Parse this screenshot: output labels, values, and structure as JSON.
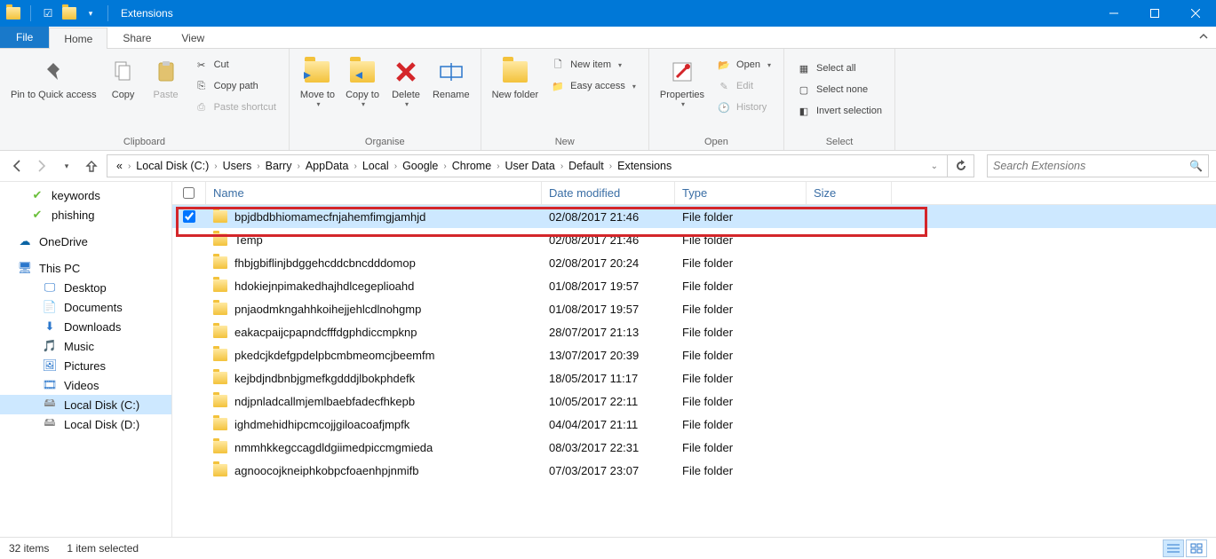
{
  "window": {
    "title": "Extensions"
  },
  "tabs": {
    "file": "File",
    "home": "Home",
    "share": "Share",
    "view": "View"
  },
  "ribbon": {
    "clipboard": {
      "label": "Clipboard",
      "pin": "Pin to Quick access",
      "copy": "Copy",
      "paste": "Paste",
      "cut": "Cut",
      "copypath": "Copy path",
      "pasteshortcut": "Paste shortcut"
    },
    "organise": {
      "label": "Organise",
      "moveto": "Move to",
      "copyto": "Copy to",
      "delete": "Delete",
      "rename": "Rename"
    },
    "new": {
      "label": "New",
      "newfolder": "New folder",
      "newitem": "New item",
      "easyaccess": "Easy access"
    },
    "open": {
      "label": "Open",
      "properties": "Properties",
      "open": "Open",
      "edit": "Edit",
      "history": "History"
    },
    "select": {
      "label": "Select",
      "selectall": "Select all",
      "selectnone": "Select none",
      "invert": "Invert selection"
    }
  },
  "breadcrumb": [
    "Local Disk (C:)",
    "Users",
    "Barry",
    "AppData",
    "Local",
    "Google",
    "Chrome",
    "User Data",
    "Default",
    "Extensions"
  ],
  "search": {
    "placeholder": "Search Extensions"
  },
  "navpane": {
    "keywords": "keywords",
    "phishing": "phishing",
    "onedrive": "OneDrive",
    "thispc": "This PC",
    "desktop": "Desktop",
    "documents": "Documents",
    "downloads": "Downloads",
    "music": "Music",
    "pictures": "Pictures",
    "videos": "Videos",
    "localc": "Local Disk (C:)",
    "locald": "Local Disk (D:)"
  },
  "columns": {
    "name": "Name",
    "date": "Date modified",
    "type": "Type",
    "size": "Size"
  },
  "files": [
    {
      "name": "bpjdbdbhiomamecfnjahemfimgjamhjd",
      "date": "02/08/2017 21:46",
      "type": "File folder",
      "selected": true
    },
    {
      "name": "Temp",
      "date": "02/08/2017 21:46",
      "type": "File folder"
    },
    {
      "name": "fhbjgbiflinjbdggehcddcbncdddomop",
      "date": "02/08/2017 20:24",
      "type": "File folder"
    },
    {
      "name": "hdokiejnpimakedhajhdlcegeplioahd",
      "date": "01/08/2017 19:57",
      "type": "File folder"
    },
    {
      "name": "pnjaodmkngahhkoihejjehlcdlnohgmp",
      "date": "01/08/2017 19:57",
      "type": "File folder"
    },
    {
      "name": "eakacpaijcpapndcfffdgphdiccmpknp",
      "date": "28/07/2017 21:13",
      "type": "File folder"
    },
    {
      "name": "pkedcjkdefgpdelpbcmbmeomcjbeemfm",
      "date": "13/07/2017 20:39",
      "type": "File folder"
    },
    {
      "name": "kejbdjndbnbjgmefkgdddjlbokphdefk",
      "date": "18/05/2017 11:17",
      "type": "File folder"
    },
    {
      "name": "ndjpnladcallmjemlbaebfadecfhkepb",
      "date": "10/05/2017 22:11",
      "type": "File folder"
    },
    {
      "name": "ighdmehidhipcmcojjgiloacoafjmpfk",
      "date": "04/04/2017 21:11",
      "type": "File folder"
    },
    {
      "name": "nmmhkkegccagdldgiimedpiccmgmieda",
      "date": "08/03/2017 22:31",
      "type": "File folder"
    },
    {
      "name": "agnoocojkneiphkobpcfoaenhpjnmifb",
      "date": "07/03/2017 23:07",
      "type": "File folder"
    }
  ],
  "status": {
    "items": "32 items",
    "selected": "1 item selected"
  }
}
